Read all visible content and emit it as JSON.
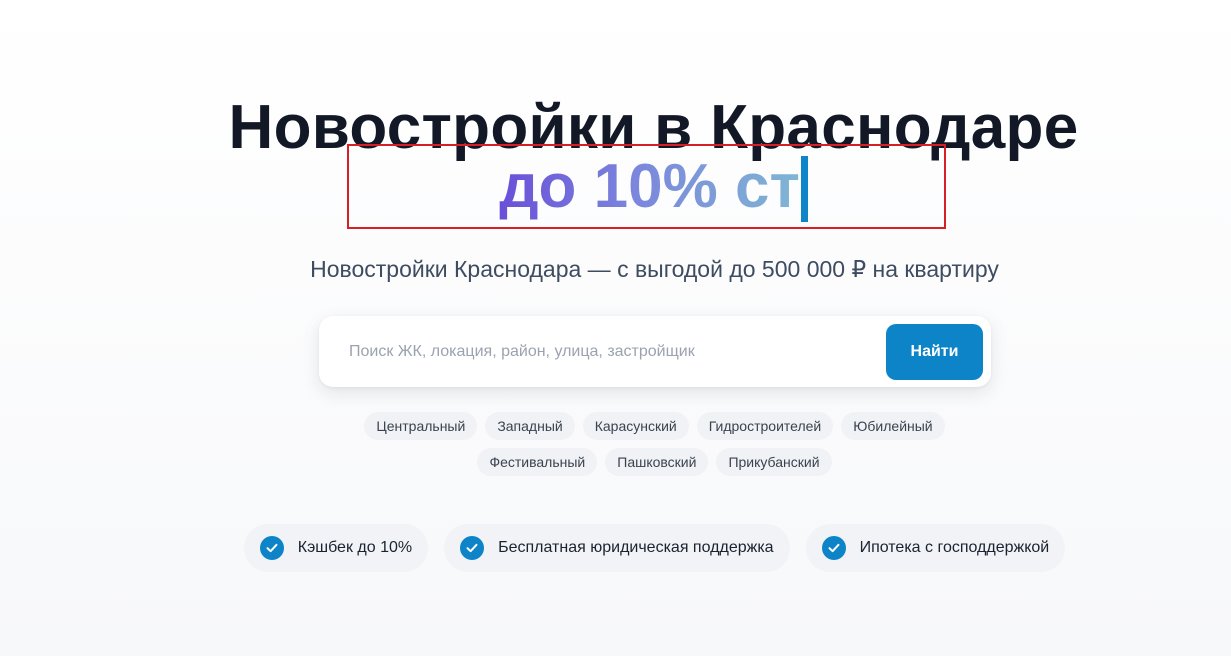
{
  "hero": {
    "title": "Новостройки в Краснодаре",
    "typed_text": "до 10% ст",
    "subtitle": "Новостройки Краснодара — с выгодой до 500 000 ₽ на квартиру"
  },
  "search": {
    "placeholder": "Поиск ЖК, локация, район, улица, застройщик",
    "value": "",
    "button_label": "Найти"
  },
  "districts": {
    "row1": [
      "Центральный",
      "Западный",
      "Карасунский",
      "Гидростроителей",
      "Юбилейный"
    ],
    "row2": [
      "Фестивальный",
      "Пашковский",
      "Прикубанский"
    ]
  },
  "benefits": [
    {
      "label": "Кэшбек до 10%",
      "icon": "check-circle-icon"
    },
    {
      "label": "Бесплатная юридическая поддержка",
      "icon": "check-circle-icon"
    },
    {
      "label": "Ипотека с господдержкой",
      "icon": "check-circle-icon"
    }
  ],
  "colors": {
    "accent": "#0d84c8",
    "title": "#121826",
    "highlight_box": "#d61f26"
  }
}
